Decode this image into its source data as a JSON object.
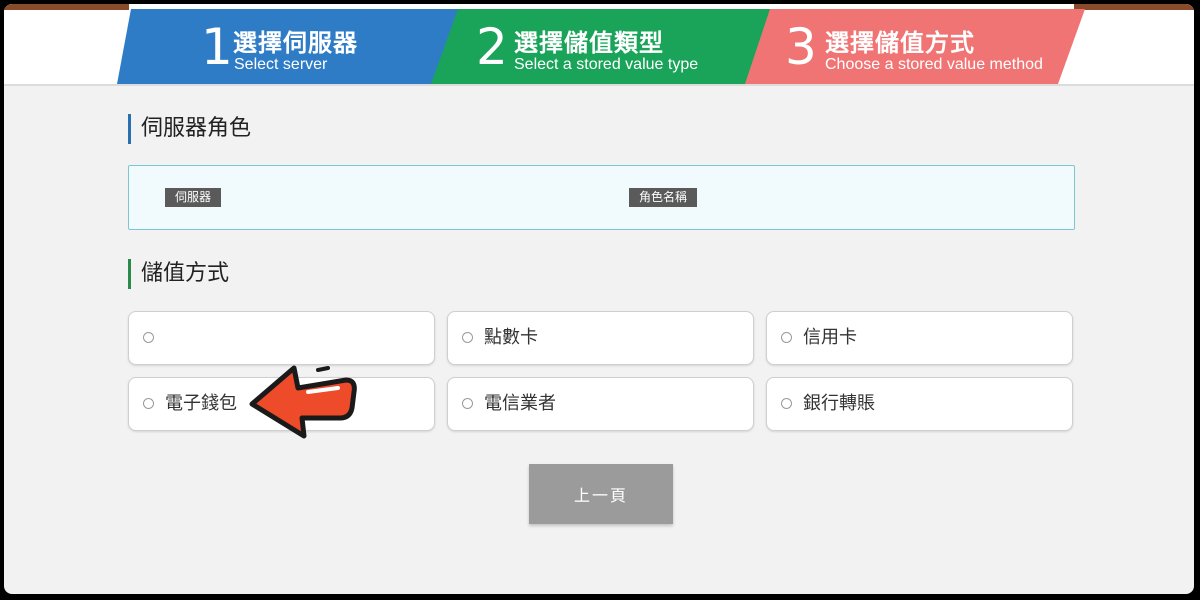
{
  "steps": [
    {
      "number": "1",
      "title": "選擇伺服器",
      "subtitle": "Select server",
      "color": "#2f7cc6"
    },
    {
      "number": "2",
      "title": "選擇儲值類型",
      "subtitle": "Select a stored value type",
      "color": "#1aa45a"
    },
    {
      "number": "3",
      "title": "選擇儲值方式",
      "subtitle": "Choose a stored value method",
      "color": "#f07474"
    }
  ],
  "server_role": {
    "heading": "伺服器角色",
    "server_tag": "伺服器",
    "role_name_tag": "角色名稱"
  },
  "payment": {
    "heading": "儲值方式",
    "options": [
      {
        "label": ""
      },
      {
        "label": "點數卡"
      },
      {
        "label": "信用卡"
      },
      {
        "label": "電子錢包"
      },
      {
        "label": "電信業者"
      },
      {
        "label": "銀行轉賬"
      }
    ]
  },
  "back_button": "上一頁",
  "colors": {
    "page_bg": "#f2f2f2",
    "role_box_bg": "#f1fafd",
    "role_box_border": "#7cc7d0",
    "arrow": "#ee4b2b",
    "button_bg": "#9b9b9b"
  }
}
